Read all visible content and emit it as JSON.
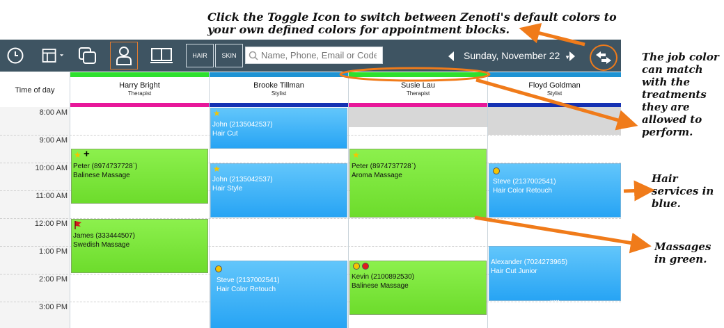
{
  "annotations": {
    "top": "Click the Toggle Icon to switch between Zenoti's default colors to your own defined colors for appointment blocks.",
    "job_color": "The job color can match with the treatments they are allowed to perform.",
    "hair": "Hair services in blue.",
    "massages": "Massages in green."
  },
  "toolbar": {
    "hair_label": "HAIR",
    "skin_label": "SKIN",
    "search_placeholder": "Name, Phone, Email or Code",
    "date": "Sunday, November 22"
  },
  "grid": {
    "time_header": "Time of day",
    "times": [
      "8:00 AM",
      "9:00 AM",
      "10:00 AM",
      "11:00 AM",
      "12:00 PM",
      "1:00 PM",
      "2:00 PM",
      "3:00 PM"
    ]
  },
  "columns": [
    {
      "name": "Harry Bright",
      "role": "Therapist"
    },
    {
      "name": "Brooke Tillman",
      "role": "Stylist"
    },
    {
      "name": "Susie Lau",
      "role": "Therapist"
    },
    {
      "name": "Floyd Goldman",
      "role": "Stylist"
    }
  ],
  "colors": {
    "hair_blue": "#27a4f4",
    "massage_green": "#6ddc2c",
    "therapist_bar": "#e8179a",
    "stylist_bar": "#1531b3",
    "toolbar": "#3e5462",
    "annotation_orange": "#f07b1a"
  },
  "appointments": {
    "harry_1": {
      "client": "Peter (8974737728`)",
      "service": "Balinese Massage"
    },
    "harry_2": {
      "client": "James (333444507)",
      "service": "Swedish Massage"
    },
    "brooke_1": {
      "client": "John (2135042537)",
      "service": "Hair Cut"
    },
    "brooke_2": {
      "client": "John (2135042537)",
      "service": "Hair Style"
    },
    "brooke_3": {
      "client": "Steve (2137002541)",
      "service": "Hair Color Retouch"
    },
    "susie_1": {
      "client": "Peter (8974737728`)",
      "service": "Aroma Massage"
    },
    "susie_2": {
      "client": "Kevin (2100892530)",
      "service": "Balinese Massage"
    },
    "floyd_1": {
      "client": "Steve (2137002541)",
      "service": "Hair Color Retouch"
    },
    "floyd_2": {
      "client": "Alexander (7024273965)",
      "service": "Hair Cut Junior"
    },
    "floyd_more": "....."
  }
}
